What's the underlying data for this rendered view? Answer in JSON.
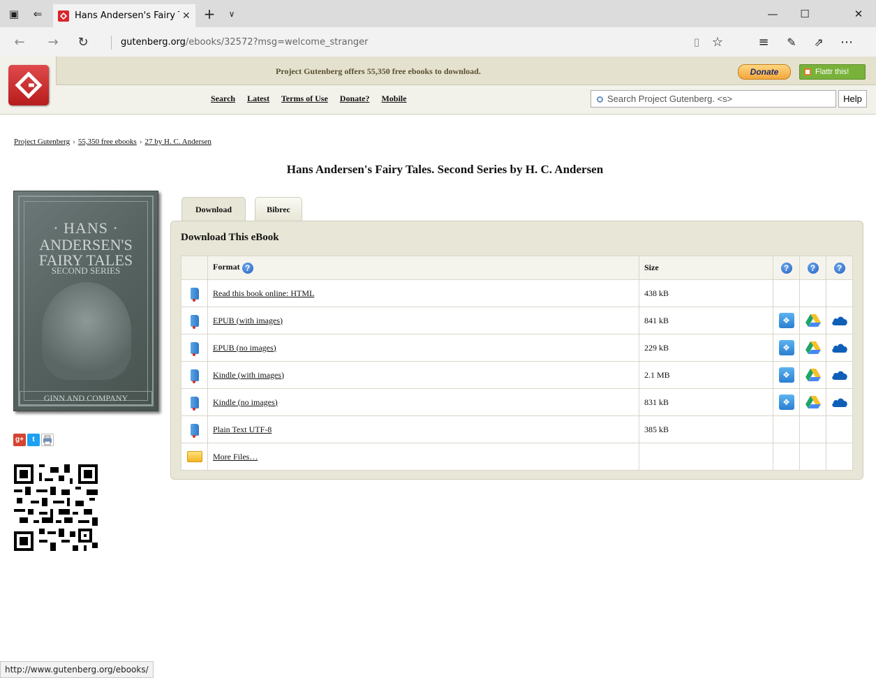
{
  "browser": {
    "tab_title": "Hans Andersen's Fairy T",
    "url_host": "gutenberg.org",
    "url_path": "/ebooks/32572?msg=welcome_stranger",
    "status_url": "http://www.gutenberg.org/ebooks/"
  },
  "header": {
    "offers_text": "Project Gutenberg offers 55,350 free ebooks to download.",
    "donate_label": "Donate",
    "flattr_label": "Flattr this!",
    "menu": [
      "Search",
      "Latest",
      "Terms of Use",
      "Donate?",
      "Mobile"
    ],
    "search_placeholder": "Search Project Gutenberg. <s>",
    "help_label": "Help"
  },
  "breadcrumb": [
    "Project Gutenberg",
    "55,350 free ebooks",
    "27 by H. C. Andersen"
  ],
  "title": "Hans Andersen's Fairy Tales. Second Series by H. C. Andersen",
  "cover": {
    "line1": "· HANS ·",
    "line2": "ANDERSEN'S",
    "line3": "FAIRY TALES",
    "line4": "SECOND SERIES",
    "publisher": "GINN AND COMPANY"
  },
  "tabs": [
    "Download",
    "Bibrec"
  ],
  "download": {
    "heading": "Download This eBook",
    "col_format": "Format",
    "col_size": "Size",
    "rows": [
      {
        "label": "Read this book online: HTML",
        "size": "438 kB",
        "cloud": false,
        "icon": "book-icon"
      },
      {
        "label": "EPUB (with images)",
        "size": "841 kB",
        "cloud": true,
        "icon": "book-icon"
      },
      {
        "label": "EPUB (no images)",
        "size": "229 kB",
        "cloud": true,
        "icon": "book-icon"
      },
      {
        "label": "Kindle (with images)",
        "size": "2.1 MB",
        "cloud": true,
        "icon": "book-icon"
      },
      {
        "label": "Kindle (no images)",
        "size": "831 kB",
        "cloud": true,
        "icon": "book-icon"
      },
      {
        "label": "Plain Text UTF-8",
        "size": "385 kB",
        "cloud": false,
        "icon": "book-icon"
      },
      {
        "label": "More Files…",
        "size": "",
        "cloud": false,
        "icon": "folder-icon"
      }
    ]
  },
  "colors": {
    "header_bg": "#f2f1ea",
    "panel_bg": "#e8e6d6",
    "logo_red": "#c62828",
    "flattr_green": "#79b23a"
  }
}
